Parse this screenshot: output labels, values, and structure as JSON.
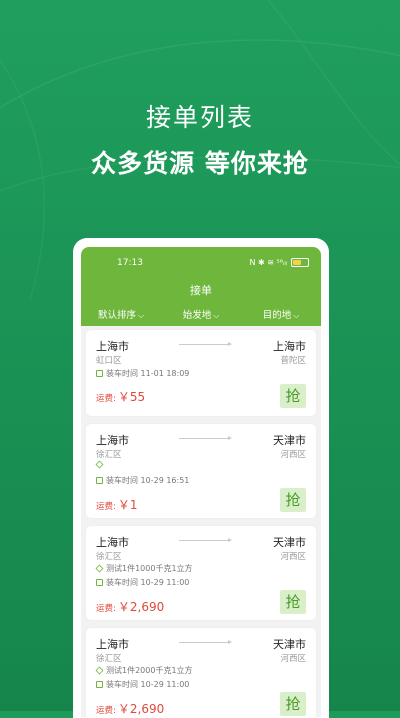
{
  "headline": {
    "line1": "接单列表",
    "line2": "众多货源 等你来抢"
  },
  "status": {
    "time": "17:13",
    "icons": "N ✱ ≋ ⁵⁶ᵢₗₗ"
  },
  "app": {
    "title": "接单"
  },
  "filters": [
    {
      "label": "默认排序"
    },
    {
      "label": "始发地"
    },
    {
      "label": "目的地"
    }
  ],
  "orders": [
    {
      "from": "上海市",
      "from_district": "虹口区",
      "to": "上海市",
      "to_district": "普陀区",
      "goods": "",
      "load_time": "装车时间 11-01 18:09",
      "fee_label": "运费:",
      "fee": "￥55",
      "action": "抢"
    },
    {
      "from": "上海市",
      "from_district": "徐汇区",
      "to": "天津市",
      "to_district": "河西区",
      "goods": "",
      "load_time": "装车时间 10-29 16:51",
      "fee_label": "运费:",
      "fee": "￥1",
      "action": "抢"
    },
    {
      "from": "上海市",
      "from_district": "徐汇区",
      "to": "天津市",
      "to_district": "河西区",
      "goods": "测试1件1000千克1立方",
      "load_time": "装车时间 10-29 11:00",
      "fee_label": "运费:",
      "fee": "￥2,690",
      "action": "抢"
    },
    {
      "from": "上海市",
      "from_district": "徐汇区",
      "to": "天津市",
      "to_district": "河西区",
      "goods": "测试1件2000千克1立方",
      "load_time": "装车时间 10-29 11:00",
      "fee_label": "运费:",
      "fee": "￥2,690",
      "action": "抢"
    }
  ],
  "colors": {
    "background": "#1e9a5a",
    "appbar": "#6fb63d",
    "fee": "#e2493b",
    "grab_bg": "#d9efc9"
  }
}
